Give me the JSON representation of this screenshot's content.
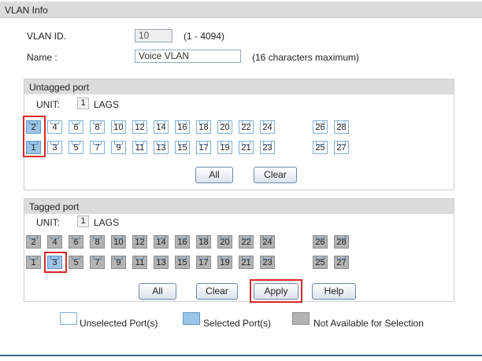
{
  "vlan_info": {
    "title": "VLAN Info",
    "vlan_id_label": "VLAN ID.",
    "vlan_id_value": "10",
    "vlan_id_range": "(1 - 4094)",
    "name_label": "Name :",
    "name_value": "Voice VLAN",
    "name_hint": "(16 characters maximum)"
  },
  "untagged": {
    "title": "Untagged port",
    "unit_label": "UNIT:",
    "unit_value": "1",
    "lags_label": "LAGS",
    "selected_ports": [
      "1",
      "2"
    ],
    "buttons": {
      "all": "All",
      "clear": "Clear"
    }
  },
  "tagged": {
    "title": "Tagged port",
    "unit_label": "UNIT:",
    "unit_value": "1",
    "lags_label": "LAGS",
    "selected_ports": [
      "3"
    ],
    "not_available_ports": [
      "1",
      "2",
      "4",
      "5",
      "6",
      "7",
      "8",
      "9",
      "10",
      "11",
      "12",
      "13",
      "14",
      "15",
      "16",
      "17",
      "18",
      "19",
      "20",
      "21",
      "22",
      "23",
      "24",
      "25",
      "26",
      "27",
      "28"
    ],
    "buttons": {
      "all": "All",
      "clear": "Clear",
      "apply": "Apply",
      "help": "Help"
    }
  },
  "port_rows": {
    "top": [
      "2",
      "4",
      "6",
      "8",
      "10",
      "12",
      "14",
      "16",
      "18",
      "20",
      "22",
      "24"
    ],
    "bottom": [
      "1",
      "3",
      "5",
      "7",
      "9",
      "11",
      "13",
      "15",
      "17",
      "19",
      "21",
      "23"
    ],
    "extra_top": [
      "26",
      "28"
    ],
    "extra_bottom": [
      "25",
      "27"
    ]
  },
  "legend": {
    "unselected": "Unselected Port(s)",
    "selected": "Selected Port(s)",
    "not_available": "Not Available for Selection"
  },
  "colors": {
    "accent": "#3b6f96",
    "highlight": "#d62a2a",
    "selected_port": "#9cc4e6",
    "unavailable_port": "#b4b4b4"
  }
}
